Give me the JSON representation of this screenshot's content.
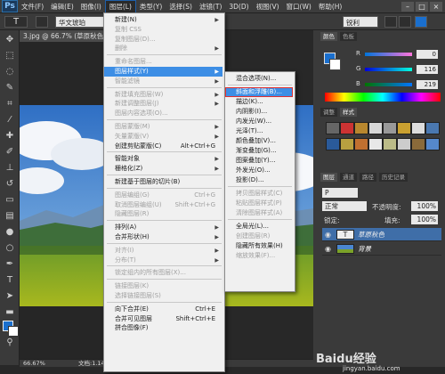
{
  "app": {
    "logo": "Ps"
  },
  "menubar": [
    "文件(F)",
    "编辑(E)",
    "图像(I)",
    "图层(L)",
    "类型(Y)",
    "选择(S)",
    "滤镜(T)",
    "3D(D)",
    "视图(V)",
    "窗口(W)",
    "帮助(H)"
  ],
  "window_controls": [
    "–",
    "□",
    "×"
  ],
  "options": {
    "tool_glyph": "T",
    "font": "华文琥珀",
    "antialias": "锐利"
  },
  "document": {
    "tab": "3.jpg @ 66.7% (草原秋色, RGB/8",
    "zoom": "66.67%",
    "info": "文档:1.14M"
  },
  "main_menu": [
    {
      "label": "新建(N)",
      "arrow": true
    },
    {
      "label": "复制 CSS",
      "disabled": true
    },
    {
      "label": "复制图层(D)...",
      "disabled": true
    },
    {
      "label": "删除",
      "arrow": true,
      "disabled": true
    },
    {
      "sep": true
    },
    {
      "label": "重命名图层...",
      "disabled": true
    },
    {
      "label": "图层样式(Y)",
      "arrow": true,
      "highlight": true
    },
    {
      "label": "智能滤镜",
      "arrow": true,
      "disabled": true
    },
    {
      "sep": true
    },
    {
      "label": "新建填充图层(W)",
      "arrow": true,
      "disabled": true
    },
    {
      "label": "新建调整图层(J)",
      "arrow": true,
      "disabled": true
    },
    {
      "label": "图层内容选项(O)...",
      "disabled": true
    },
    {
      "sep": true
    },
    {
      "label": "图层蒙版(M)",
      "arrow": true,
      "disabled": true
    },
    {
      "label": "矢量蒙版(V)",
      "arrow": true,
      "disabled": true
    },
    {
      "label": "创建剪贴蒙版(C)",
      "shortcut": "Alt+Ctrl+G"
    },
    {
      "sep": true
    },
    {
      "label": "智能对象",
      "arrow": true
    },
    {
      "label": "栅格化(Z)",
      "arrow": true
    },
    {
      "sep": true
    },
    {
      "label": "新建基于图层的切片(B)"
    },
    {
      "sep": true
    },
    {
      "label": "图层编组(G)",
      "shortcut": "Ctrl+G",
      "disabled": true
    },
    {
      "label": "取消图层编组(U)",
      "shortcut": "Shift+Ctrl+G",
      "disabled": true
    },
    {
      "label": "隐藏图层(R)",
      "disabled": true
    },
    {
      "sep": true
    },
    {
      "label": "排列(A)",
      "arrow": true
    },
    {
      "label": "合并形状(H)",
      "arrow": true
    },
    {
      "sep": true
    },
    {
      "label": "对齐(I)",
      "arrow": true,
      "disabled": true
    },
    {
      "label": "分布(T)",
      "arrow": true,
      "disabled": true
    },
    {
      "sep": true
    },
    {
      "label": "锁定组内的所有图层(X)...",
      "disabled": true
    },
    {
      "sep": true
    },
    {
      "label": "链接图层(K)",
      "disabled": true
    },
    {
      "label": "选择链接图层(S)",
      "disabled": true
    },
    {
      "sep": true
    },
    {
      "label": "向下合并(E)",
      "shortcut": "Ctrl+E"
    },
    {
      "label": "合并可见图层",
      "shortcut": "Shift+Ctrl+E"
    },
    {
      "label": "拼合图像(F)"
    }
  ],
  "sub_menu": [
    {
      "label": "混合选项(N)..."
    },
    {
      "sep": true
    },
    {
      "label": "斜面和浮雕(B)...",
      "highlight": true,
      "boxed": true
    },
    {
      "label": "描边(K)..."
    },
    {
      "label": "内阴影(I)..."
    },
    {
      "label": "内发光(W)..."
    },
    {
      "label": "光泽(T)..."
    },
    {
      "label": "颜色叠加(V)..."
    },
    {
      "label": "渐变叠加(G)..."
    },
    {
      "label": "图案叠加(Y)..."
    },
    {
      "label": "外发光(O)..."
    },
    {
      "label": "投影(D)..."
    },
    {
      "sep": true
    },
    {
      "label": "拷贝图层样式(C)",
      "disabled": true
    },
    {
      "label": "粘贴图层样式(P)",
      "disabled": true
    },
    {
      "label": "清除图层样式(A)",
      "disabled": true
    },
    {
      "sep": true
    },
    {
      "label": "全局光(L)..."
    },
    {
      "label": "创建图层(R)",
      "disabled": true
    },
    {
      "label": "隐藏所有效果(H)"
    },
    {
      "label": "缩放效果(F)...",
      "disabled": true
    }
  ],
  "color_panel": {
    "tabs": [
      "颜色",
      "色板"
    ],
    "channels": [
      {
        "label": "R",
        "value": "0"
      },
      {
        "label": "G",
        "value": "116"
      },
      {
        "label": "B",
        "value": "219"
      }
    ]
  },
  "styles_panel": {
    "tabs": [
      "调整",
      "样式"
    ]
  },
  "layers_panel": {
    "tabs": [
      "图层",
      "通道",
      "路径",
      "历史记录"
    ],
    "blend_mode": "正常",
    "opacity_label": "不透明度:",
    "opacity": "100%",
    "lock_label": "锁定:",
    "fill_label": "填充:",
    "fill": "100%",
    "layers": [
      {
        "name": "草原秋色",
        "type": "T",
        "selected": true
      },
      {
        "name": "背景"
      }
    ]
  },
  "watermark": {
    "text": "Baidu经验",
    "url": "jingyan.baidu.com"
  },
  "colors": {
    "accent": "#3d8ee5",
    "fg": "#1a6fce",
    "highlight_box": "#e03030"
  }
}
